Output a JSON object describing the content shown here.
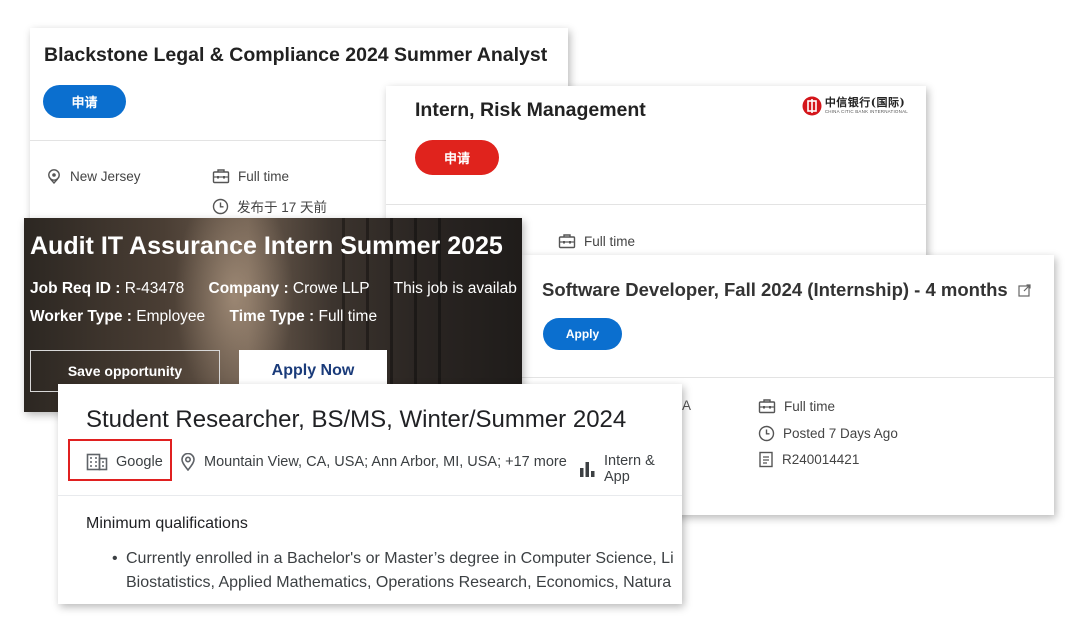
{
  "blackstone": {
    "title": "Blackstone Legal & Compliance 2024 Summer Analyst",
    "apply_label": "申请",
    "location": "New Jersey",
    "job_type": "Full time",
    "posted": "发布于 17 天前"
  },
  "citic": {
    "title": "Intern, Risk Management",
    "apply_label": "申请",
    "logo_cn": "中信银行(国际)",
    "logo_en": "CHINA CITIC BANK INTERNATIONAL",
    "job_type": "Full time"
  },
  "audit": {
    "title": "Audit IT Assurance Intern Summer 2025",
    "job_req_label": "Job Req ID :",
    "job_req_value": "R-43478",
    "company_label": "Company :",
    "company_value": "Crowe LLP",
    "availability_text": "This job is availab",
    "worker_type_label": "Worker Type :",
    "worker_type_value": "Employee",
    "time_type_label": "Time Type :",
    "time_type_value": "Full time",
    "save_label": "Save opportunity",
    "apply_label": "Apply Now"
  },
  "software": {
    "title": "Software Developer, Fall 2024 (Internship) - 4 months",
    "apply_label": "Apply",
    "location_fragment": "A",
    "job_type": "Full time",
    "posted": "Posted 7 Days Ago",
    "req_id": "R240014421"
  },
  "google": {
    "title": "Student Researcher, BS/MS, Winter/Summer 2024",
    "company": "Google",
    "locations": "Mountain View, CA, USA; Ann Arbor, MI, USA; +17 more",
    "level": "Intern & App",
    "min_qual_heading": "Minimum qualifications",
    "bullet_line1": "Currently enrolled in a Bachelor's or Master’s degree in Computer Science, Li",
    "bullet_line2": "Biostatistics, Applied Mathematics, Operations Research, Economics, Natura"
  },
  "colors": {
    "blue_button": "#0b6fcf",
    "red_button": "#e0231d",
    "highlight_box": "#e02020"
  }
}
